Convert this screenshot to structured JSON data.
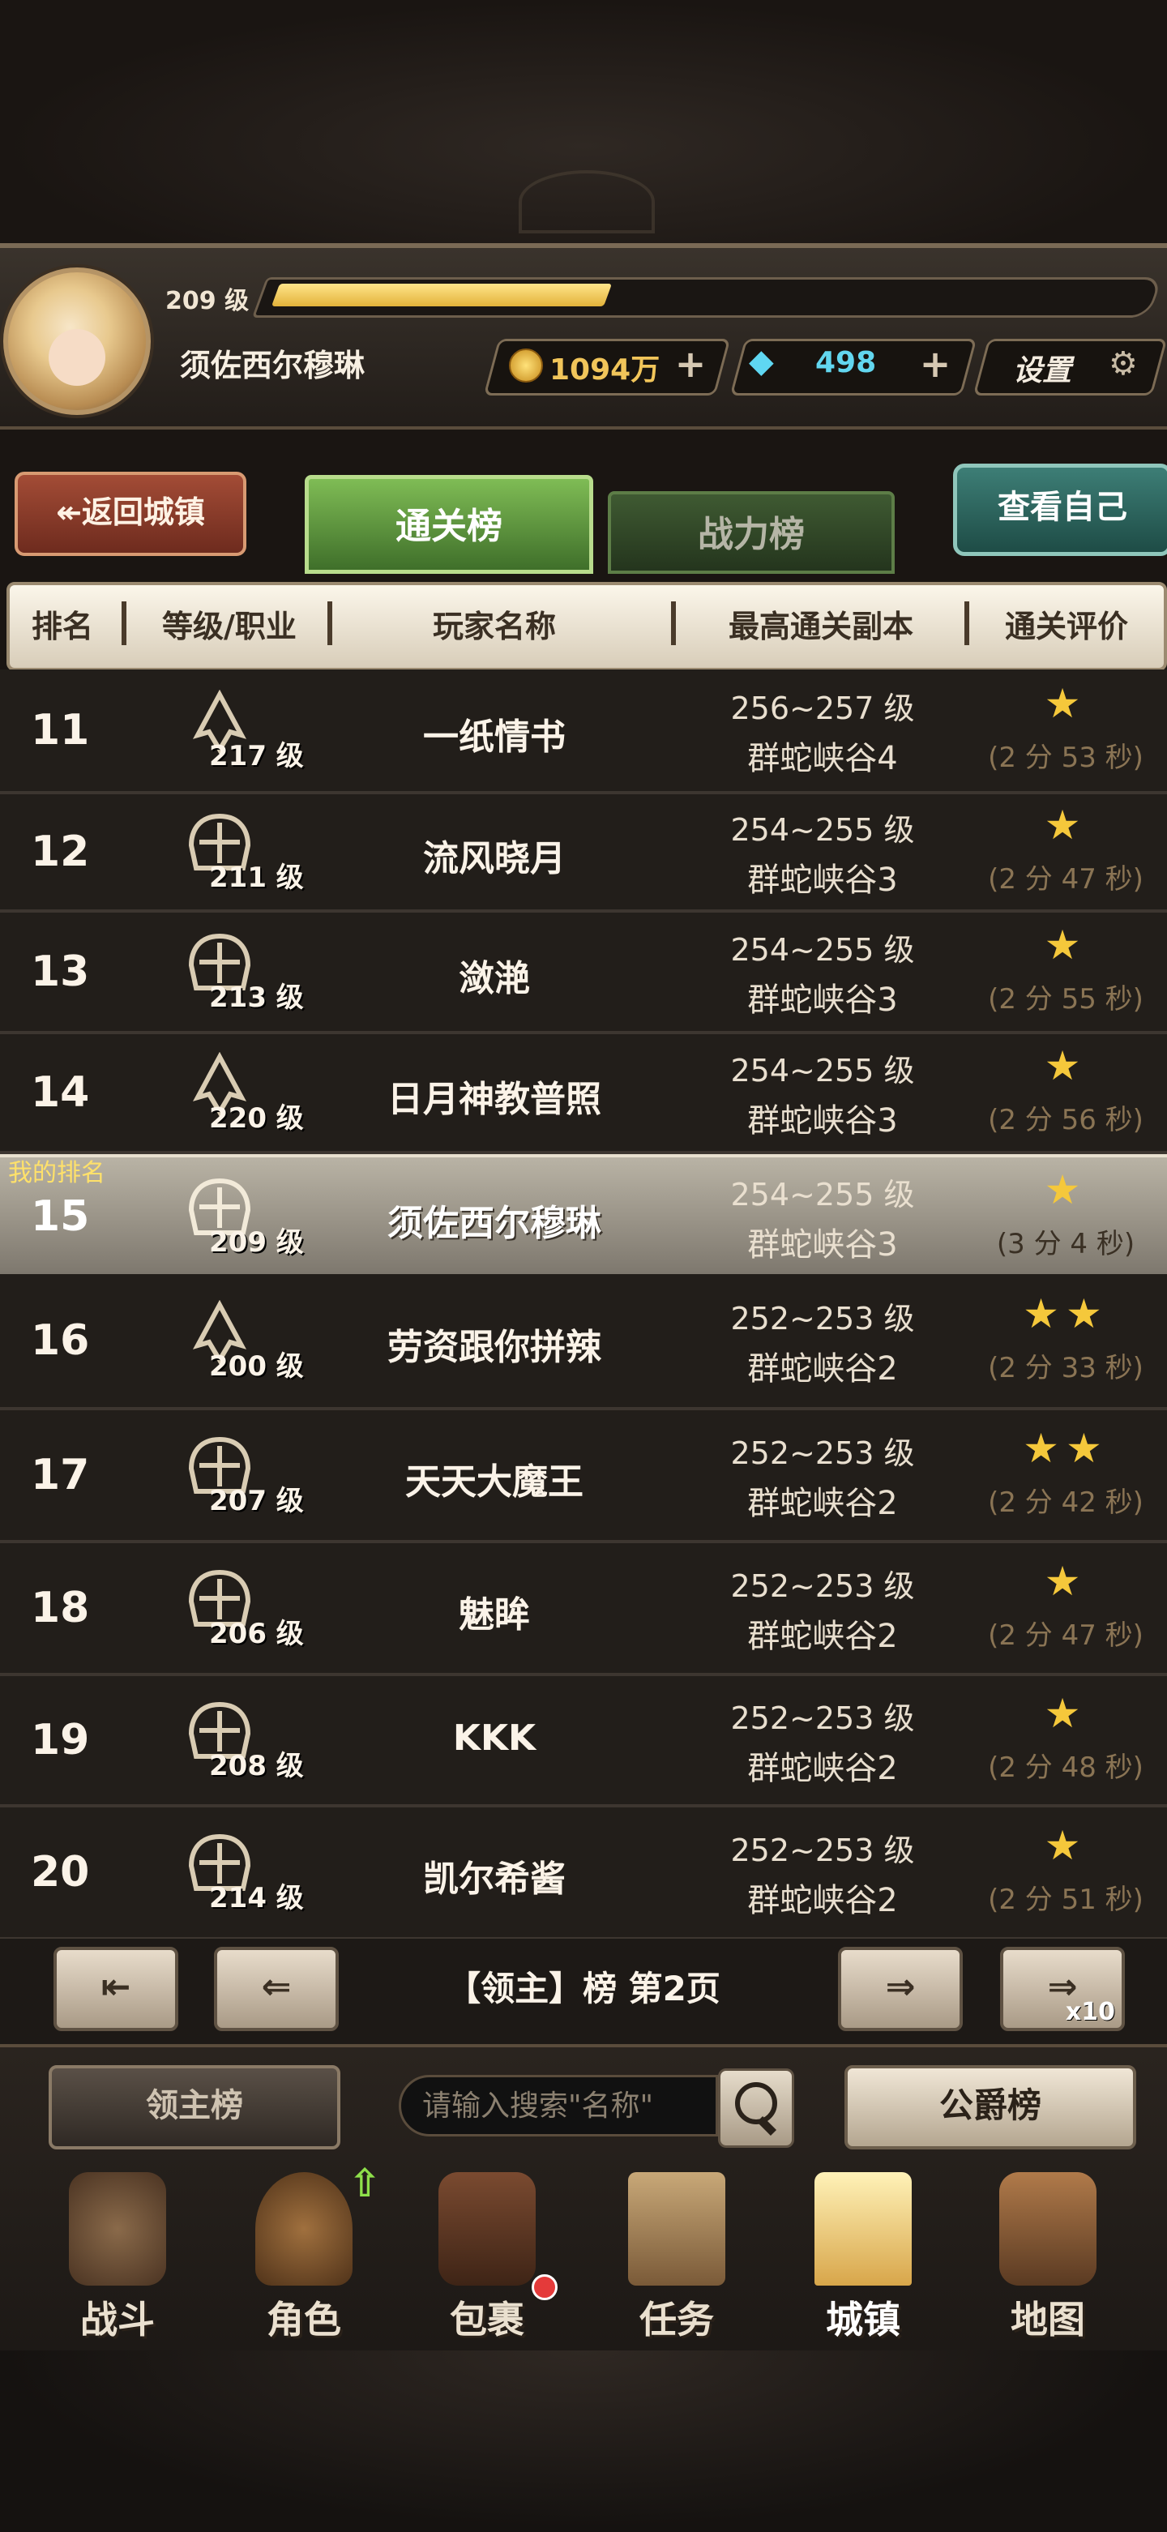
{
  "header": {
    "level": "209 级",
    "player_name": "须佐西尔穆琳",
    "xp_fraction": 0.38,
    "gold": "1094万",
    "diamonds": "498",
    "plus": "+",
    "settings": "设置"
  },
  "tabs": {
    "back": "↞返回城镇",
    "clear_rank": "通关榜",
    "power_rank": "战力榜",
    "view_self": "查看自己"
  },
  "table_header": {
    "rank": "排名",
    "level_class": "等级/职业",
    "player": "玩家名称",
    "dungeon": "最高通关副本",
    "rating": "通关评价"
  },
  "my_rank_tag": "我的排名",
  "rows": [
    {
      "rank": "11",
      "level": "217 级",
      "class": "crest",
      "name": "一纸情书",
      "dungeon_level": "256~257 级",
      "dungeon": "群蛇峡谷4",
      "stars": "★",
      "time": "(2 分 53 秒)"
    },
    {
      "rank": "12",
      "level": "211 级",
      "class": "helm",
      "name": "流风晓月",
      "dungeon_level": "254~255 级",
      "dungeon": "群蛇峡谷3",
      "stars": "★",
      "time": "(2 分 47 秒)"
    },
    {
      "rank": "13",
      "level": "213 级",
      "class": "helm",
      "name": "潋滟",
      "dungeon_level": "254~255 级",
      "dungeon": "群蛇峡谷3",
      "stars": "★",
      "time": "(2 分 55 秒)"
    },
    {
      "rank": "14",
      "level": "220 级",
      "class": "crest",
      "name": "日月神教普照",
      "dungeon_level": "254~255 级",
      "dungeon": "群蛇峡谷3",
      "stars": "★",
      "time": "(2 分 56 秒)"
    },
    {
      "rank": "15",
      "level": "209 级",
      "class": "helm",
      "name": "须佐西尔穆琳",
      "dungeon_level": "254~255 级",
      "dungeon": "群蛇峡谷3",
      "stars": "★",
      "time": "(3 分 4 秒)",
      "mine": true
    },
    {
      "rank": "16",
      "level": "200 级",
      "class": "crest",
      "name": "劳资跟你拼辣",
      "dungeon_level": "252~253 级",
      "dungeon": "群蛇峡谷2",
      "stars": "★★",
      "time": "(2 分 33 秒)"
    },
    {
      "rank": "17",
      "level": "207 级",
      "class": "helm",
      "name": "天天大魔王",
      "dungeon_level": "252~253 级",
      "dungeon": "群蛇峡谷2",
      "stars": "★★",
      "time": "(2 分 42 秒)"
    },
    {
      "rank": "18",
      "level": "206 级",
      "class": "helm",
      "name": "魅眸",
      "dungeon_level": "252~253 级",
      "dungeon": "群蛇峡谷2",
      "stars": "★",
      "time": "(2 分 47 秒)"
    },
    {
      "rank": "19",
      "level": "208 级",
      "class": "helm",
      "name": "KKK",
      "dungeon_level": "252~253 级",
      "dungeon": "群蛇峡谷2",
      "stars": "★",
      "time": "(2 分 48 秒)"
    },
    {
      "rank": "20",
      "level": "214 级",
      "class": "helm",
      "name": "凯尔希酱",
      "dungeon_level": "252~253 级",
      "dungeon": "群蛇峡谷2",
      "stars": "★",
      "time": "(2 分 51 秒)"
    }
  ],
  "pager": {
    "first": "⇤",
    "prev": "⇐",
    "label": "【领主】榜 第2页",
    "next": "⇒",
    "jump": "⇒",
    "jump_badge": "x10"
  },
  "bottom": {
    "lord_rank": "领主榜",
    "search_placeholder": "请输入搜索\"名称\"",
    "duke_rank": "公爵榜"
  },
  "nav": [
    {
      "label": "战斗",
      "icon": "battle-shield-icon"
    },
    {
      "label": "角色",
      "icon": "helmet-icon",
      "upgrade": true
    },
    {
      "label": "包裹",
      "icon": "backpack-icon",
      "badge": true
    },
    {
      "label": "任务",
      "icon": "scroll-icon"
    },
    {
      "label": "城镇",
      "icon": "castle-tower-icon",
      "active": true
    },
    {
      "label": "地图",
      "icon": "map-icon"
    }
  ],
  "colors": {
    "star": "#f5c83b",
    "gold_text": "#f1c55a",
    "diamond_text": "#62d6ef",
    "tab_active": "#6aa544",
    "back_button": "#8f3d2a",
    "view_self_button": "#2f6a62",
    "my_row": "#a9a397"
  }
}
